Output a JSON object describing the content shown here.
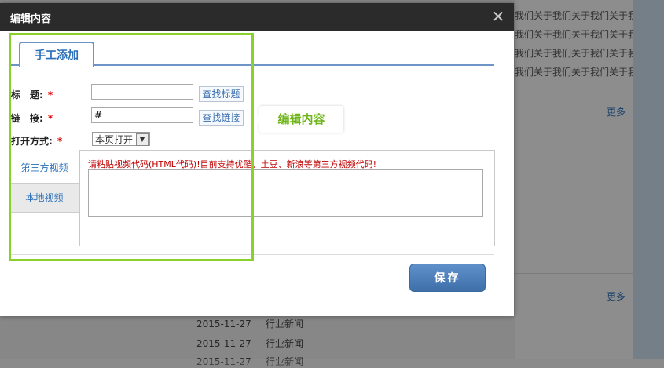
{
  "background": {
    "side_text_lines": [
      "我们关于我们关于我们关于我们关于",
      "我们关于我们关于我们关于我们关于",
      "我们关于我们关于我们关于我",
      "我们关于我们关于我们关于我们"
    ],
    "more_label_1": "更多",
    "more_label_2": "更多",
    "news": [
      {
        "date": "2015-11-27",
        "title": "行业新闻"
      },
      {
        "date": "2015-11-27",
        "title": "行业新闻"
      },
      {
        "date": "2015-11-27",
        "title": "行业新闻"
      }
    ]
  },
  "modal": {
    "title": "编辑内容",
    "close_symbol": "✕",
    "tab_manual": "手工添加",
    "title_label": "标　题:",
    "title_value": "",
    "find_title_button": "查找标题",
    "link_label": "链　接:",
    "link_value": "#",
    "find_link_button": "查找链接",
    "open_mode_label": "打开方式:",
    "open_mode_value": "本页打开",
    "required_mark": "*",
    "video_tab_third_party": "第三方视频",
    "video_tab_local": "本地视频",
    "video_hint": "请粘贴视频代码(HTML代码)!目前支持优酷、土豆、新浪等第三方视频代码!",
    "save_button": "保存"
  },
  "tutorial": {
    "callout_text": "编辑内容",
    "highlight_color": "#8bd12c",
    "callout_color": "#6fb51b"
  }
}
